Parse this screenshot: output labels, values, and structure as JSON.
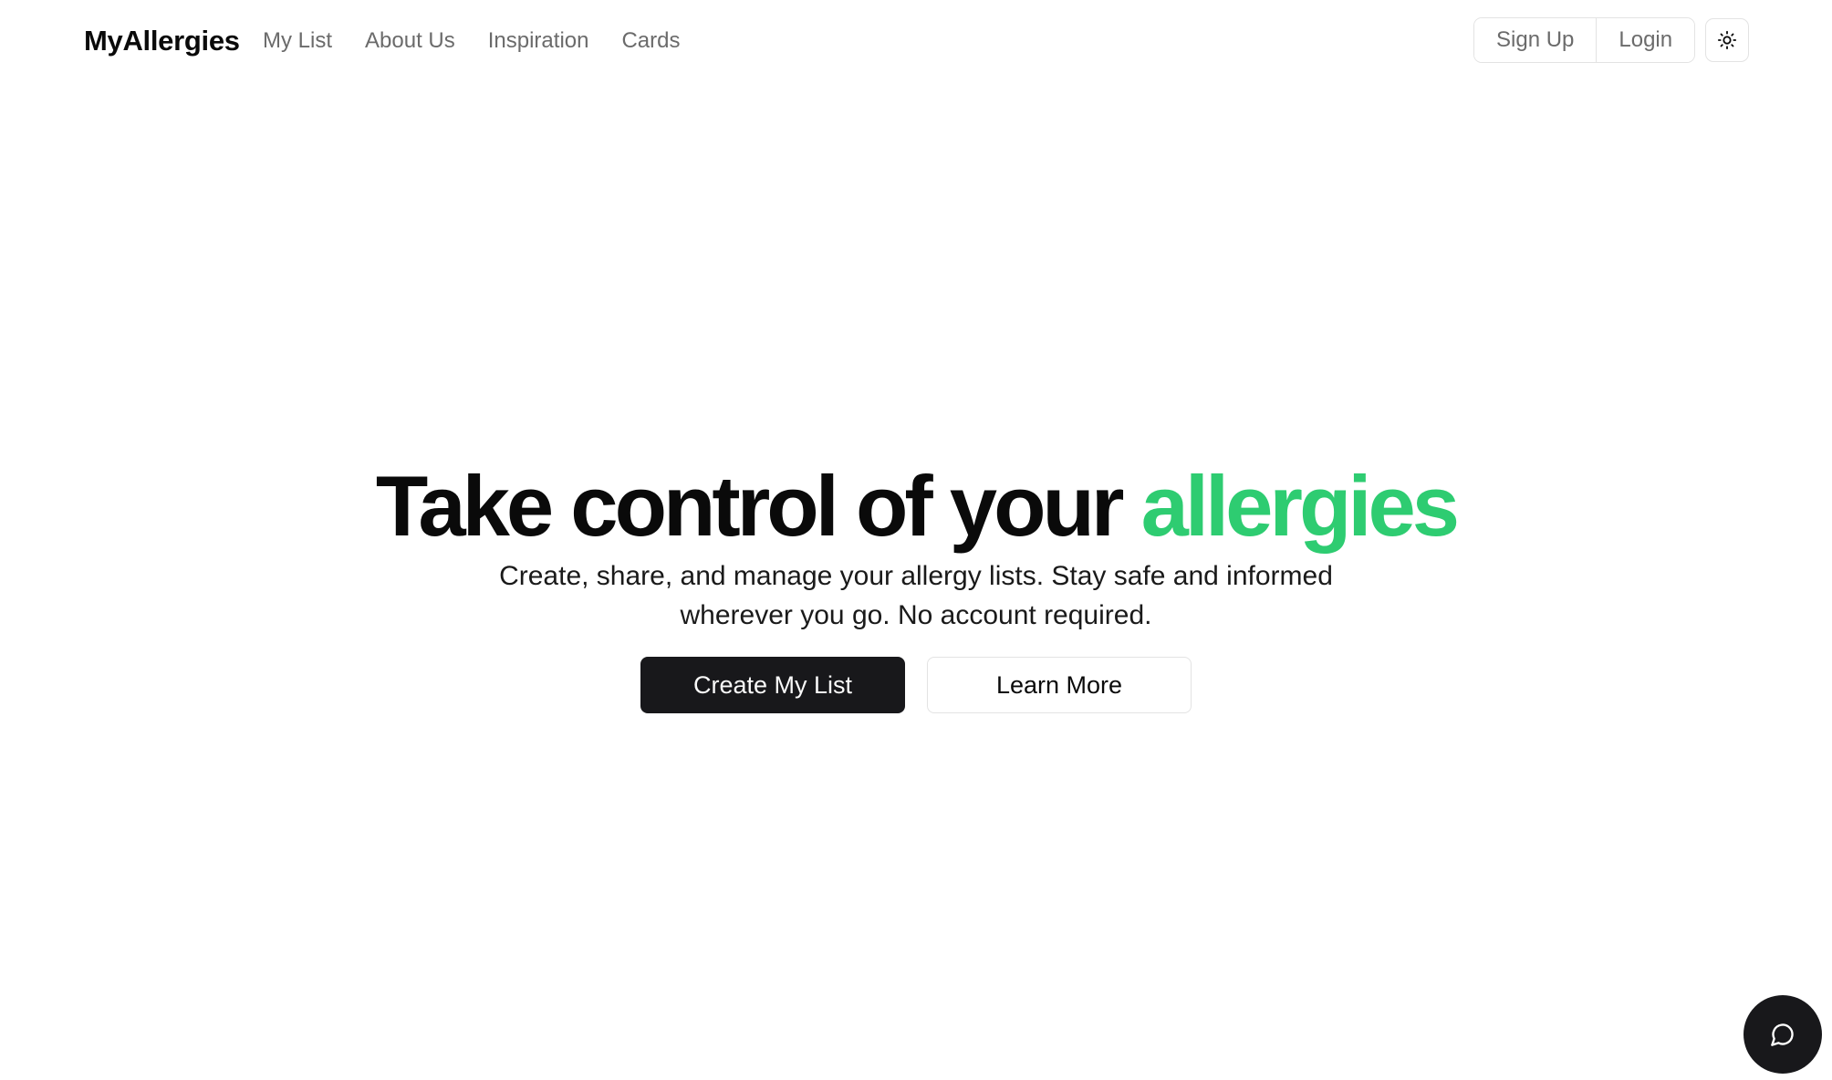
{
  "nav": {
    "brand": "MyAllergies",
    "links": [
      "My List",
      "About Us",
      "Inspiration",
      "Cards"
    ],
    "signup_label": "Sign Up",
    "login_label": "Login",
    "theme_icon": "sun-icon"
  },
  "hero": {
    "title_prefix": "Take control of your",
    "title_accent": "allergies",
    "subtitle": "Create, share, and manage your allergy lists. Stay safe and informed wherever you go. No account required.",
    "primary_cta": "Create My List",
    "secondary_cta": "Learn More"
  },
  "chat": {
    "icon": "chat-bubble-icon"
  },
  "colors": {
    "accent": "#2ecc71",
    "primary_button": "#18181b",
    "muted_text": "#6b6b6b",
    "border": "#e3e3e3"
  }
}
